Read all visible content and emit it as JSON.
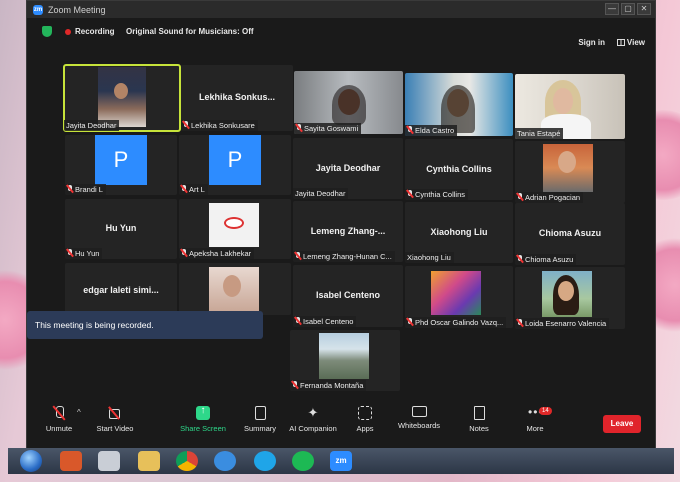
{
  "window": {
    "title": "Zoom Meeting",
    "controls": [
      "—",
      "▢",
      "✕"
    ]
  },
  "status": {
    "recording_label": "Recording",
    "original_sound_label": "Original Sound for Musicians: Off",
    "signin_label": "Sign in",
    "view_label": "View"
  },
  "participants": [
    {
      "name": "Jayita Deodhar",
      "type": "video",
      "active": true
    },
    {
      "name": "Lekhika Sonkusare",
      "display": "Lekhika  Sonkus...",
      "type": "name"
    },
    {
      "name": "Sayita Goswami",
      "type": "video"
    },
    {
      "name": "Elda Castro",
      "type": "video"
    },
    {
      "name": "Tania Estapé",
      "type": "video"
    },
    {
      "name": "Brandi L",
      "type": "avatar",
      "initial": "P"
    },
    {
      "name": "Art L",
      "type": "avatar",
      "initial": "P"
    },
    {
      "name": "Jayita Deodhar",
      "display": "Jayita Deodhar",
      "type": "name"
    },
    {
      "name": "Cynthia Collins",
      "display": "Cynthia Collins",
      "type": "name"
    },
    {
      "name": "Adrian Pogacian",
      "type": "video"
    },
    {
      "name": "Hu Yun",
      "display": "Hu Yun",
      "type": "name"
    },
    {
      "name": "Apeksha Lakhekar",
      "type": "video"
    },
    {
      "name": "Lemeng Zhang-Hunan C...",
      "display": "Lemeng  Zhang-...",
      "type": "name"
    },
    {
      "name": "Xiaohong Liu",
      "display": "Xiaohong Liu",
      "type": "name"
    },
    {
      "name": "Chioma Asuzu",
      "display": "Chioma Asuzu",
      "type": "name"
    },
    {
      "name": "edgar laleti simi...",
      "display": "edgar  laleti simi...",
      "type": "name"
    },
    {
      "name": "",
      "type": "video"
    },
    {
      "name": "Isabel Centeno",
      "display": "Isabel Centeno",
      "type": "name"
    },
    {
      "name": "Phd Oscar Galindo Vazq...",
      "type": "video"
    },
    {
      "name": "Loida Esenarro Valencia",
      "type": "video"
    },
    {
      "name": "Fernanda Montaña",
      "type": "video"
    }
  ],
  "toast": "This meeting is being recorded.",
  "toolbar": {
    "unmute": "Unmute",
    "start_video": "Start Video",
    "share_screen": "Share Screen",
    "summary": "Summary",
    "ai_companion": "AI Companion",
    "apps": "Apps",
    "whiteboards": "Whiteboards",
    "notes": "Notes",
    "more": "More",
    "more_badge": "14",
    "leave": "Leave"
  },
  "taskbar": {
    "zoom_label": "zm"
  },
  "colors": {
    "accent_active": "#c6e33a",
    "leave_red": "#e0242b",
    "share_green": "#2ed88a",
    "zoom_blue": "#2d8cff"
  }
}
